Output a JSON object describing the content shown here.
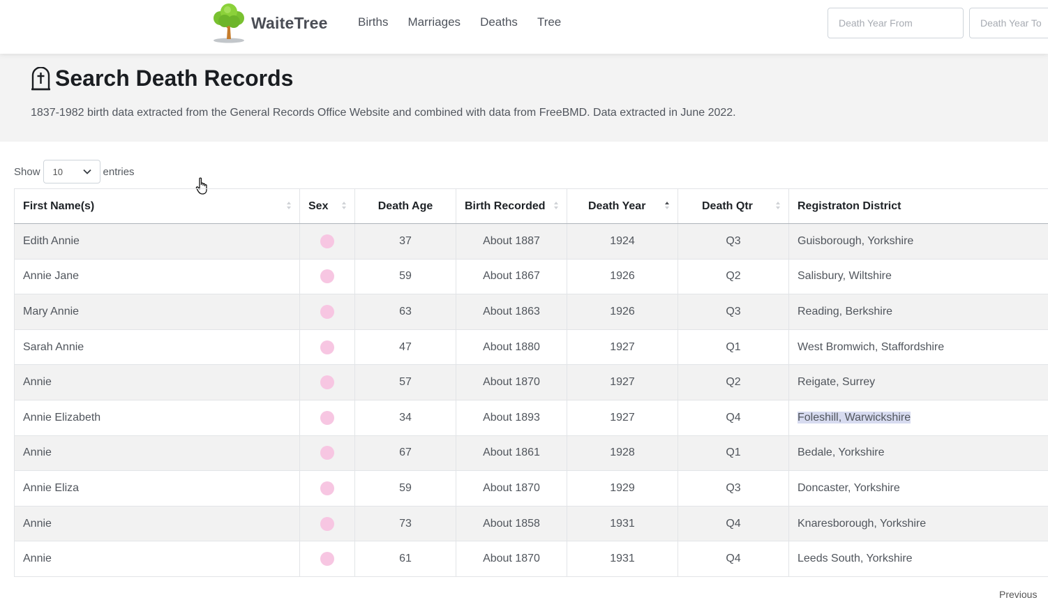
{
  "nav": {
    "brand": "WaiteTree",
    "links": [
      "Births",
      "Marriages",
      "Deaths",
      "Tree"
    ],
    "year_from_placeholder": "Death Year From",
    "year_to_placeholder": "Death Year To"
  },
  "header": {
    "title": "Search Death Records",
    "subtitle": "1837-1982 birth data extracted from the General Records Office Website and combined with data from FreeBMD. Data extracted in June 2022."
  },
  "length": {
    "show": "Show",
    "value": "10",
    "entries": "entries"
  },
  "table": {
    "columns": [
      "First Name(s)",
      "Sex",
      "Death Age",
      "Birth Recorded",
      "Death Year",
      "Death Qtr",
      "Registraton District"
    ],
    "rows": [
      [
        "Edith Annie",
        "",
        "37",
        "About 1887",
        "1924",
        "Q3",
        "Guisborough, Yorkshire"
      ],
      [
        "Annie Jane",
        "",
        "59",
        "About 1867",
        "1926",
        "Q2",
        "Salisbury, Wiltshire"
      ],
      [
        "Mary Annie",
        "",
        "63",
        "About 1863",
        "1926",
        "Q3",
        "Reading, Berkshire"
      ],
      [
        "Sarah Annie",
        "",
        "47",
        "About 1880",
        "1927",
        "Q1",
        "West Bromwich, Staffordshire"
      ],
      [
        "Annie",
        "",
        "57",
        "About 1870",
        "1927",
        "Q2",
        "Reigate, Surrey"
      ],
      [
        "Annie Elizabeth",
        "",
        "34",
        "About 1893",
        "1927",
        "Q4",
        "Foleshill, Warwickshire"
      ],
      [
        "Annie",
        "",
        "67",
        "About 1861",
        "1928",
        "Q1",
        "Bedale, Yorkshire"
      ],
      [
        "Annie Eliza",
        "",
        "59",
        "About 1870",
        "1929",
        "Q3",
        "Doncaster, Yorkshire"
      ],
      [
        "Annie",
        "",
        "73",
        "About 1858",
        "1931",
        "Q4",
        "Knaresborough, Yorkshire"
      ],
      [
        "Annie",
        "",
        "61",
        "About 1870",
        "1931",
        "Q4",
        "Leeds South, Yorkshire"
      ]
    ]
  },
  "pagination": {
    "previous": "Previous"
  },
  "colors": {
    "female_dot": "#f7c6e2",
    "header_bg": "#f3f3f3",
    "highlight": "#d7dbf0"
  }
}
